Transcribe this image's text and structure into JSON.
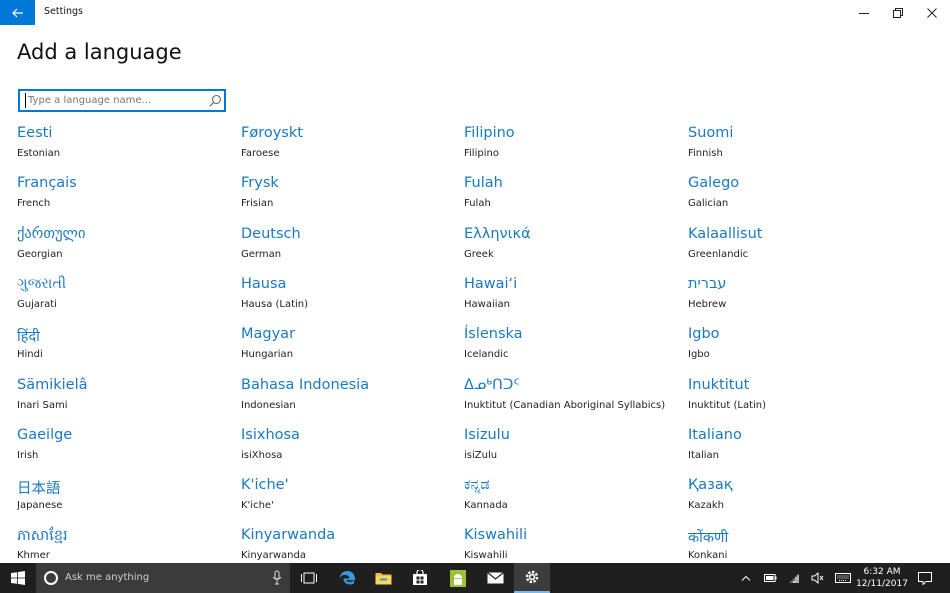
{
  "window": {
    "title": "Settings",
    "back_icon": "back-arrow-icon",
    "accent": "#0078d7"
  },
  "page": {
    "title": "Add a language"
  },
  "search": {
    "placeholder": "Type a language name...",
    "value": ""
  },
  "languages": [
    {
      "native": "Eesti",
      "english": "Estonian"
    },
    {
      "native": "Føroyskt",
      "english": "Faroese"
    },
    {
      "native": "Filipino",
      "english": "Filipino"
    },
    {
      "native": "Suomi",
      "english": "Finnish"
    },
    {
      "native": "Français",
      "english": "French"
    },
    {
      "native": "Frysk",
      "english": "Frisian"
    },
    {
      "native": "Fulah",
      "english": "Fulah"
    },
    {
      "native": "Galego",
      "english": "Galician"
    },
    {
      "native": "ქართული",
      "english": "Georgian"
    },
    {
      "native": "Deutsch",
      "english": "German"
    },
    {
      "native": "Ελληνικά",
      "english": "Greek"
    },
    {
      "native": "Kalaallisut",
      "english": "Greenlandic"
    },
    {
      "native": "ગુજરાતી",
      "english": "Gujarati"
    },
    {
      "native": "Hausa",
      "english": "Hausa (Latin)"
    },
    {
      "native": "Hawaiʻi",
      "english": "Hawaiian"
    },
    {
      "native": "עברית",
      "english": "Hebrew"
    },
    {
      "native": "हिंदी",
      "english": "Hindi"
    },
    {
      "native": "Magyar",
      "english": "Hungarian"
    },
    {
      "native": "Íslenska",
      "english": "Icelandic"
    },
    {
      "native": "Igbo",
      "english": "Igbo"
    },
    {
      "native": "Sämikielâ",
      "english": "Inari Sami"
    },
    {
      "native": "Bahasa Indonesia",
      "english": "Indonesian"
    },
    {
      "native": "ᐃᓄᒃᑎᑐᑦ",
      "english": "Inuktitut (Canadian Aboriginal Syllabics)"
    },
    {
      "native": "Inuktitut",
      "english": "Inuktitut (Latin)"
    },
    {
      "native": "Gaeilge",
      "english": "Irish"
    },
    {
      "native": "Isixhosa",
      "english": "isiXhosa"
    },
    {
      "native": "Isizulu",
      "english": "isiZulu"
    },
    {
      "native": "Italiano",
      "english": "Italian"
    },
    {
      "native": "日本語",
      "english": "Japanese"
    },
    {
      "native": "K'iche'",
      "english": "K'iche'"
    },
    {
      "native": "ಕನ್ನಡ",
      "english": "Kannada"
    },
    {
      "native": "Қазақ",
      "english": "Kazakh"
    },
    {
      "native": "ភាសាខ្មែរ",
      "english": "Khmer"
    },
    {
      "native": "Kinyarwanda",
      "english": "Kinyarwanda"
    },
    {
      "native": "Kiswahili",
      "english": "Kiswahili"
    },
    {
      "native": "कोंकणी",
      "english": "Konkani"
    }
  ],
  "taskbar": {
    "search_placeholder": "Ask me anything",
    "time": "6:32 AM",
    "date": "12/11/2017",
    "apps": [
      "task-view-icon",
      "edge-icon",
      "file-explorer-icon",
      "store-icon",
      "android-icon",
      "mail-icon",
      "settings-gear-icon"
    ]
  }
}
